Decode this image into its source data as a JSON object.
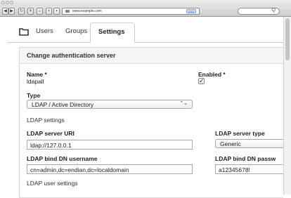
{
  "browser": {
    "url": "www.example.com",
    "rss_label": "RSS",
    "search_glyph": "Q"
  },
  "tabs": [
    {
      "label": "Users"
    },
    {
      "label": "Groups"
    },
    {
      "label": "Settings",
      "active": true
    }
  ],
  "panel": {
    "title": "Change authentication server",
    "name_label": "Name *",
    "name_value": "ldapall",
    "enabled_label": "Enabled *",
    "enabled_checked": true,
    "enabled_mark": "✓",
    "type_label": "Type",
    "type_value": "LDAP / Active Directory",
    "ldap_settings_heading": "LDAP settings",
    "server_uri_label": "LDAP server URI",
    "server_uri_value": "ldap://127.0.0.1",
    "server_type_label": "LDAP server type",
    "server_type_value": "Generic",
    "bind_dn_label": "LDAP bind DN username",
    "bind_dn_value": "cn=admin,dc=endian,dc=localdomain",
    "bind_pass_label": "LDAP bind DN passw",
    "bind_pass_value": "a12345678!",
    "user_settings_heading": "LDAP user settings"
  }
}
